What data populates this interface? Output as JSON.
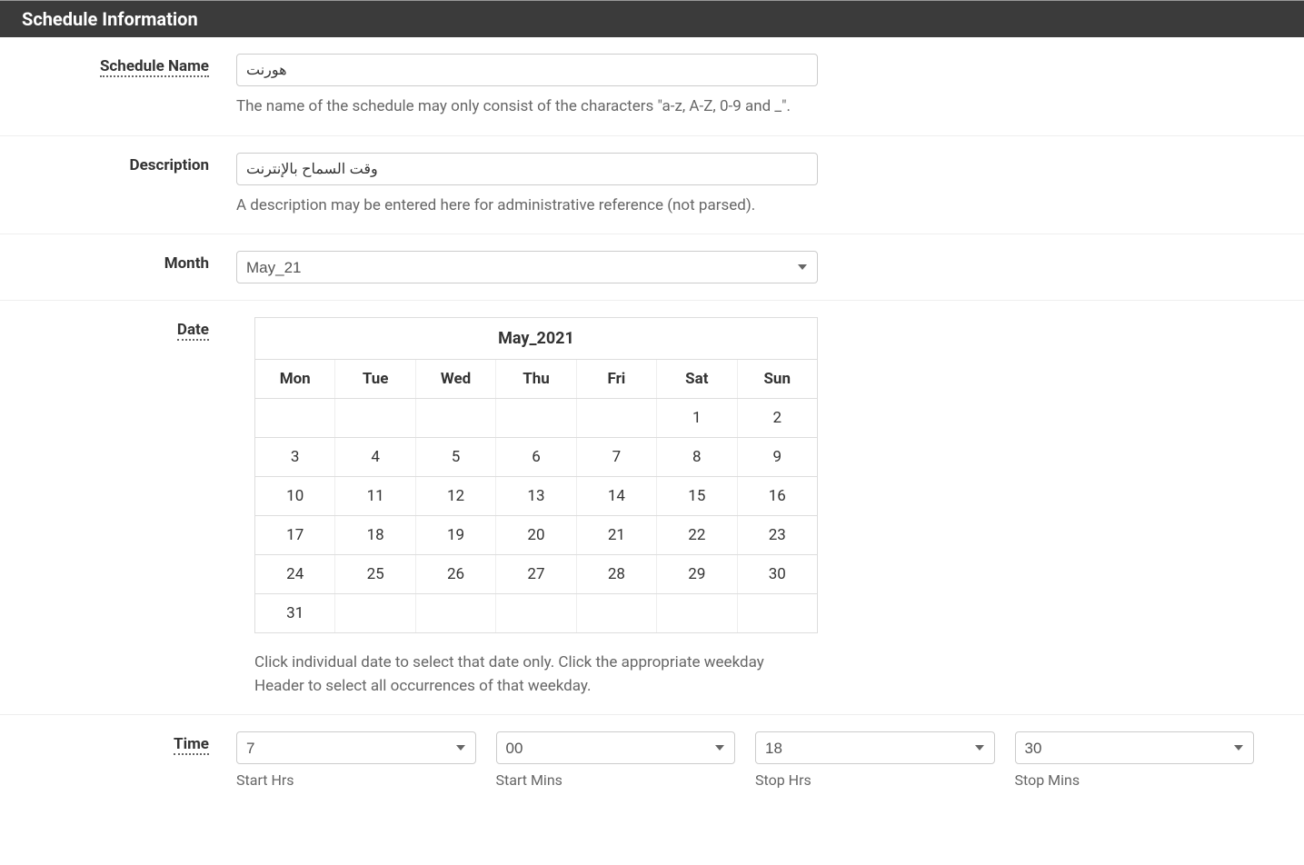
{
  "panel": {
    "title": "Schedule Information"
  },
  "fields": {
    "schedule_name": {
      "label": "Schedule Name",
      "value": "هورنت",
      "help": "The name of the schedule may only consist of the characters \"a-z, A-Z, 0-9 and _\"."
    },
    "description": {
      "label": "Description",
      "value": "وقت السماح بالإنترنت",
      "help": "A description may be entered here for administrative reference (not parsed)."
    },
    "month": {
      "label": "Month",
      "value": "May_21"
    },
    "date": {
      "label": "Date",
      "calendar_title": "May_2021",
      "weekdays": [
        "Mon",
        "Tue",
        "Wed",
        "Thu",
        "Fri",
        "Sat",
        "Sun"
      ],
      "weeks": [
        [
          "",
          "",
          "",
          "",
          "",
          "1",
          "2"
        ],
        [
          "3",
          "4",
          "5",
          "6",
          "7",
          "8",
          "9"
        ],
        [
          "10",
          "11",
          "12",
          "13",
          "14",
          "15",
          "16"
        ],
        [
          "17",
          "18",
          "19",
          "20",
          "21",
          "22",
          "23"
        ],
        [
          "24",
          "25",
          "26",
          "27",
          "28",
          "29",
          "30"
        ],
        [
          "31",
          "",
          "",
          "",
          "",
          "",
          ""
        ]
      ],
      "help": "Click individual date to select that date only. Click the appropriate weekday Header to select all occurrences of that weekday."
    },
    "time": {
      "label": "Time",
      "start_hrs": {
        "value": "7",
        "label": "Start Hrs"
      },
      "start_mins": {
        "value": "00",
        "label": "Start Mins"
      },
      "stop_hrs": {
        "value": "18",
        "label": "Stop Hrs"
      },
      "stop_mins": {
        "value": "30",
        "label": "Stop Mins"
      }
    }
  }
}
